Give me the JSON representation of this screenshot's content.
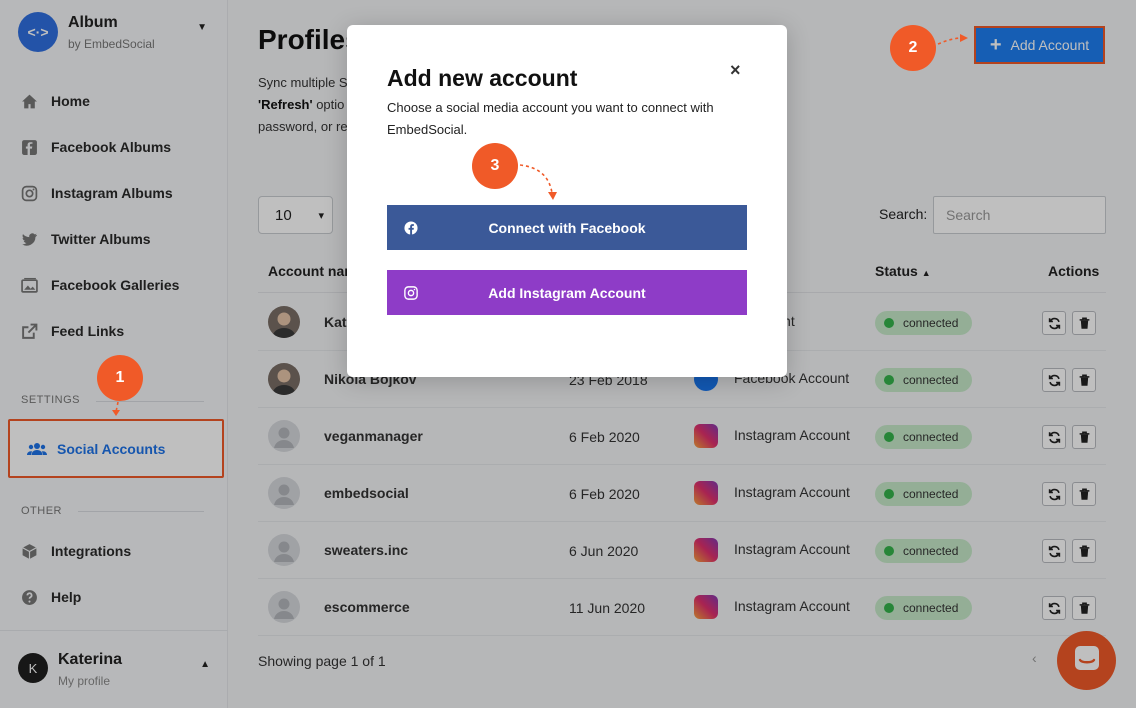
{
  "brand": {
    "name": "Album",
    "subtitle": "by EmbedSocial",
    "logo_glyph": "<·>"
  },
  "nav": {
    "items": [
      {
        "label": "Home",
        "icon": "home-icon"
      },
      {
        "label": "Facebook Albums",
        "icon": "facebook-icon"
      },
      {
        "label": "Instagram Albums",
        "icon": "instagram-icon"
      },
      {
        "label": "Twitter Albums",
        "icon": "twitter-icon"
      },
      {
        "label": "Facebook Galleries",
        "icon": "gallery-icon"
      },
      {
        "label": "Feed Links",
        "icon": "external-link-icon"
      }
    ],
    "settings_label": "SETTINGS",
    "active_item": {
      "label": "Social Accounts",
      "icon": "users-icon"
    },
    "other_label": "OTHER",
    "other_items": [
      {
        "label": "Integrations",
        "icon": "cube-icon"
      },
      {
        "label": "Help",
        "icon": "help-icon"
      }
    ]
  },
  "user": {
    "initial": "K",
    "name": "Katerina",
    "subtitle": "My profile"
  },
  "page": {
    "title": "Profiles",
    "desc_start": "Sync multiple S",
    "desc_bold": "'Refresh'",
    "desc_mid": " optio",
    "desc_end": "password, or re"
  },
  "toolbar": {
    "add_account_label": "Add Account",
    "page_size": "10",
    "search_label": "Search:",
    "search_placeholder": "Search"
  },
  "table": {
    "headers": {
      "account_name": "Account nam",
      "status": "Status",
      "actions": "Actions"
    },
    "rows": [
      {
        "name": "Kat",
        "date": "",
        "network": "k Account",
        "network_icon": "facebook-icon",
        "status": "connected",
        "avatar": "photo"
      },
      {
        "name": "Nikola Bojkov",
        "date": "23 Feb 2018",
        "network": "Facebook Account",
        "network_icon": "facebook-icon",
        "status": "connected",
        "avatar": "photo"
      },
      {
        "name": "veganmanager",
        "date": "6 Feb 2020",
        "network": "Instagram Account",
        "network_icon": "instagram-icon",
        "status": "connected",
        "avatar": "default"
      },
      {
        "name": "embedsocial",
        "date": "6 Feb 2020",
        "network": "Instagram Account",
        "network_icon": "instagram-icon",
        "status": "connected",
        "avatar": "default"
      },
      {
        "name": "sweaters.inc",
        "date": "6 Jun 2020",
        "network": "Instagram Account",
        "network_icon": "instagram-icon",
        "status": "connected",
        "avatar": "default"
      },
      {
        "name": "escommerce",
        "date": "11 Jun 2020",
        "network": "Instagram Account",
        "network_icon": "instagram-icon",
        "status": "connected",
        "avatar": "default"
      }
    ]
  },
  "footer": {
    "pagination_text": "Showing page 1 of 1",
    "prev_glyph": "‹"
  },
  "modal": {
    "title": "Add new account",
    "description": "Choose a social media account you want to connect with EmbedSocial.",
    "close_glyph": "×",
    "facebook_button": "Connect with Facebook",
    "instagram_button": "Add Instagram Account"
  },
  "callouts": [
    "1",
    "2",
    "3"
  ],
  "colors": {
    "accent": "#f05a28",
    "primary": "#1e7ef0",
    "facebook": "#3b5998",
    "instagram": "#8e3cc7",
    "status_bg": "#c6e9c9"
  }
}
